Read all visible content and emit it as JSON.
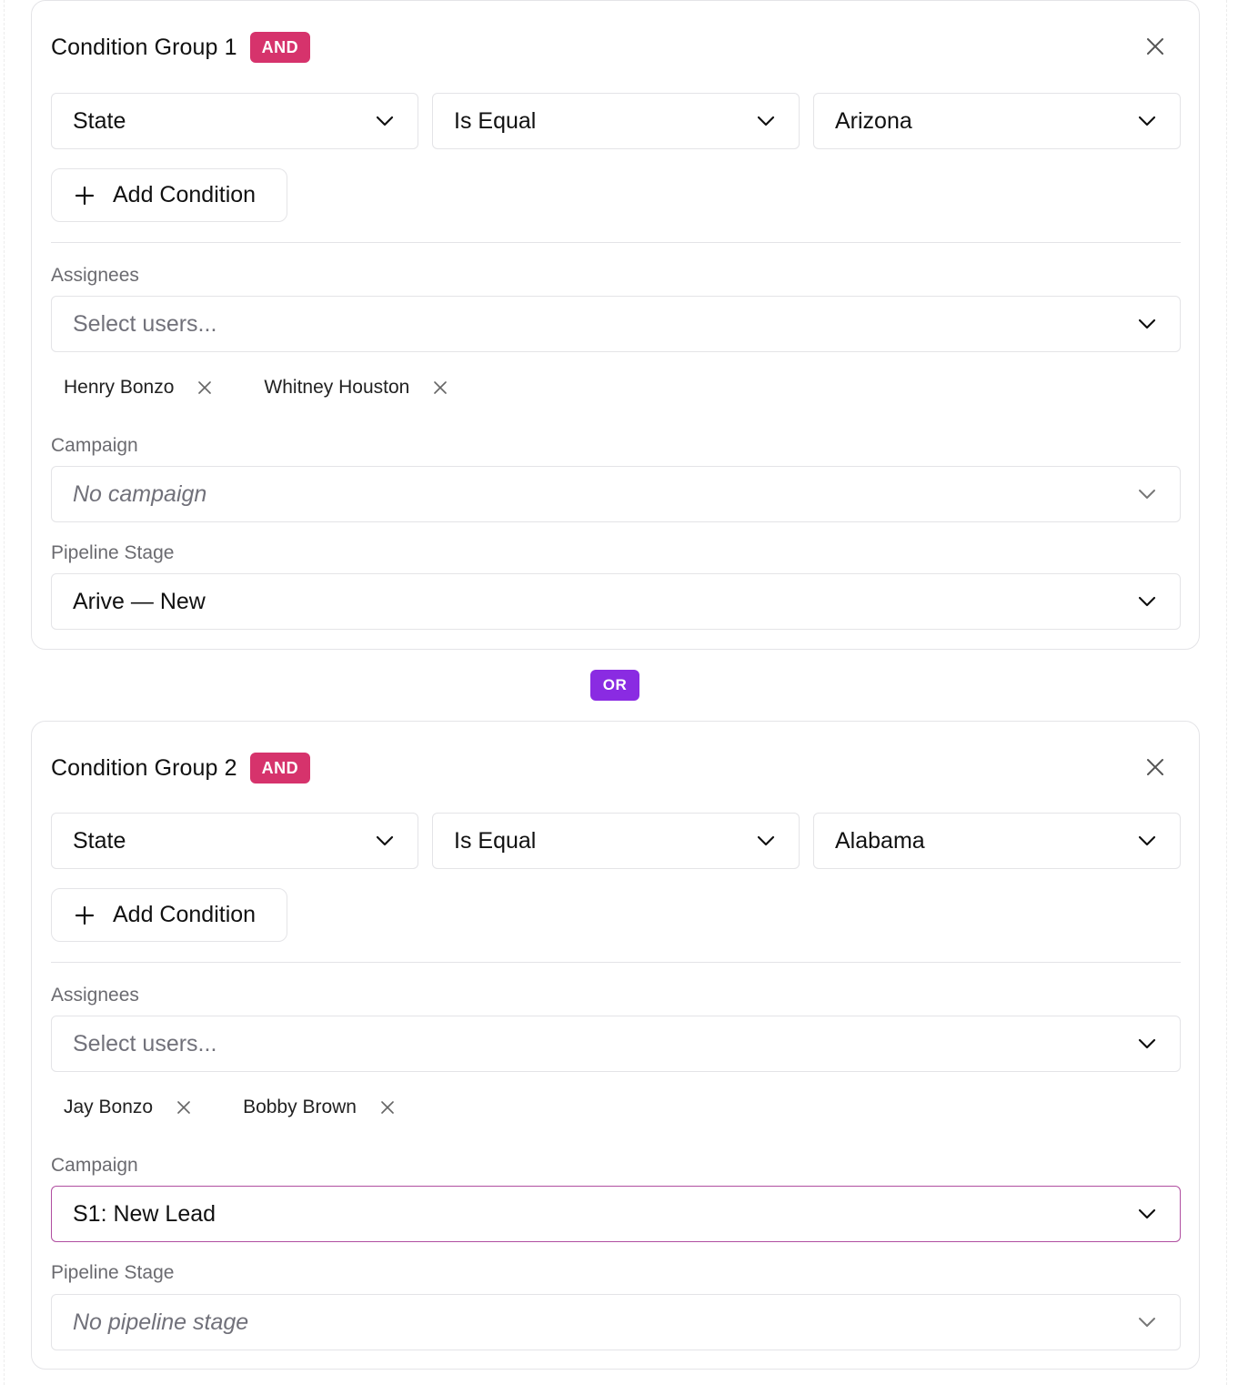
{
  "connector_label": "OR",
  "groups": [
    {
      "title": "Condition Group 1",
      "logic_badge": "AND",
      "condition": {
        "field": "State",
        "operator": "Is Equal",
        "value": "Arizona"
      },
      "add_condition_label": "Add Condition",
      "assignees_label": "Assignees",
      "assignees_placeholder": "Select users...",
      "assignees": [
        "Henry Bonzo",
        "Whitney Houston"
      ],
      "campaign_label": "Campaign",
      "campaign_value": "No campaign",
      "pipeline_label": "Pipeline Stage",
      "pipeline_value": "Arive — New"
    },
    {
      "title": "Condition Group 2",
      "logic_badge": "AND",
      "condition": {
        "field": "State",
        "operator": "Is Equal",
        "value": "Alabama"
      },
      "add_condition_label": "Add Condition",
      "assignees_label": "Assignees",
      "assignees_placeholder": "Select users...",
      "assignees": [
        "Jay Bonzo",
        "Bobby Brown"
      ],
      "campaign_label": "Campaign",
      "campaign_value": "S1: New Lead",
      "pipeline_label": "Pipeline Stage",
      "pipeline_value": "No pipeline stage"
    }
  ],
  "colors": {
    "and_badge": "#d6336c",
    "or_badge": "#8a2be2",
    "focus_border": "#b04ea0"
  }
}
